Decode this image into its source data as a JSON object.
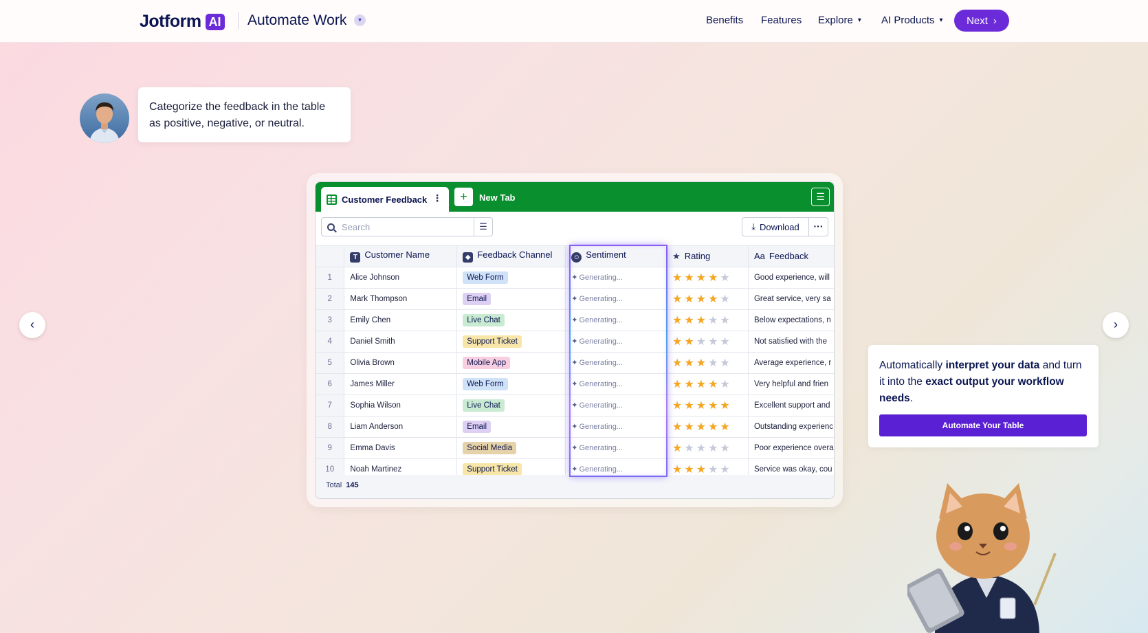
{
  "header": {
    "logo": "Jotform",
    "logo_badge": "AI",
    "product": "Automate Work",
    "nav": [
      "Benefits",
      "Features",
      "Explore",
      "AI Products"
    ],
    "next_label": "Next"
  },
  "chat": {
    "prompt": "Categorize the feedback in the table as positive, negative, or neutral."
  },
  "table": {
    "tab_active": "Customer Feedback",
    "new_tab": "New Tab",
    "search_placeholder": "Search",
    "download_label": "Download",
    "columns": [
      "Customer Name",
      "Feedback Channel",
      "Sentiment",
      "Rating",
      "Feedback"
    ],
    "column_icons": [
      "T",
      "tag",
      "smile",
      "star",
      "Aa"
    ],
    "generating_text": "Generating...",
    "rows": [
      {
        "idx": "1",
        "name": "Alice Johnson",
        "channel": "Web Form",
        "rating": 4,
        "feedback": "Good experience, will"
      },
      {
        "idx": "2",
        "name": "Mark Thompson",
        "channel": "Email",
        "rating": 4,
        "feedback": "Great service, very sa"
      },
      {
        "idx": "3",
        "name": "Emily Chen",
        "channel": "Live Chat",
        "rating": 3,
        "feedback": "Below expectations, n"
      },
      {
        "idx": "4",
        "name": "Daniel Smith",
        "channel": "Support Ticket",
        "rating": 2,
        "feedback": "Not satisfied with the"
      },
      {
        "idx": "5",
        "name": "Olivia Brown",
        "channel": "Mobile App",
        "rating": 3,
        "feedback": "Average experience, r"
      },
      {
        "idx": "6",
        "name": "James Miller",
        "channel": "Web Form",
        "rating": 4,
        "feedback": "Very helpful and frien"
      },
      {
        "idx": "7",
        "name": "Sophia Wilson",
        "channel": "Live Chat",
        "rating": 5,
        "feedback": "Excellent support and"
      },
      {
        "idx": "8",
        "name": "Liam Anderson",
        "channel": "Email",
        "rating": 5,
        "feedback": "Outstanding experienc"
      },
      {
        "idx": "9",
        "name": "Emma Davis",
        "channel": "Social Media",
        "rating": 1,
        "feedback": "Poor experience overa"
      },
      {
        "idx": "10",
        "name": "Noah Martinez",
        "channel": "Support Ticket",
        "rating": 3,
        "feedback": "Service was okay, cou"
      }
    ],
    "channel_colors": {
      "Web Form": "#cfe2f7",
      "Email": "#ddd0f3",
      "Live Chat": "#c9ebd2",
      "Support Ticket": "#f7e6a8",
      "Mobile App": "#f7cfe0",
      "Social Media": "#e6d2a9"
    },
    "total_label": "Total",
    "total_value": "145"
  },
  "info_card": {
    "text_1": "Automatically ",
    "text_2": "interpret your data",
    "text_3": " and turn it into the ",
    "text_4": "exact output your workflow needs",
    "text_5": ".",
    "button": "Automate Your Table"
  },
  "colors": {
    "brand_purple": "#6c2bd9",
    "table_green": "#0a8f2e",
    "star": "#f5a623"
  }
}
